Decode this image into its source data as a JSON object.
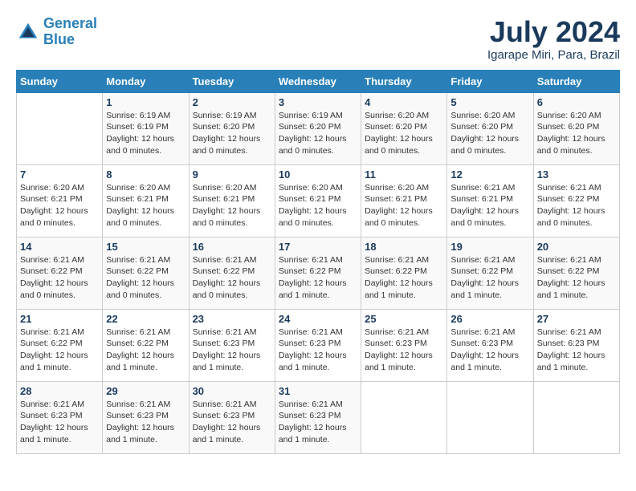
{
  "header": {
    "logo_line1": "General",
    "logo_line2": "Blue",
    "month": "July 2024",
    "location": "Igarape Miri, Para, Brazil"
  },
  "weekdays": [
    "Sunday",
    "Monday",
    "Tuesday",
    "Wednesday",
    "Thursday",
    "Friday",
    "Saturday"
  ],
  "weeks": [
    [
      {
        "day": "",
        "info": ""
      },
      {
        "day": "1",
        "info": "Sunrise: 6:19 AM\nSunset: 6:19 PM\nDaylight: 12 hours and 0 minutes."
      },
      {
        "day": "2",
        "info": "Sunrise: 6:19 AM\nSunset: 6:20 PM\nDaylight: 12 hours and 0 minutes."
      },
      {
        "day": "3",
        "info": "Sunrise: 6:19 AM\nSunset: 6:20 PM\nDaylight: 12 hours and 0 minutes."
      },
      {
        "day": "4",
        "info": "Sunrise: 6:20 AM\nSunset: 6:20 PM\nDaylight: 12 hours and 0 minutes."
      },
      {
        "day": "5",
        "info": "Sunrise: 6:20 AM\nSunset: 6:20 PM\nDaylight: 12 hours and 0 minutes."
      },
      {
        "day": "6",
        "info": "Sunrise: 6:20 AM\nSunset: 6:20 PM\nDaylight: 12 hours and 0 minutes."
      }
    ],
    [
      {
        "day": "7",
        "info": "Sunrise: 6:20 AM\nSunset: 6:21 PM\nDaylight: 12 hours and 0 minutes."
      },
      {
        "day": "8",
        "info": "Sunrise: 6:20 AM\nSunset: 6:21 PM\nDaylight: 12 hours and 0 minutes."
      },
      {
        "day": "9",
        "info": "Sunrise: 6:20 AM\nSunset: 6:21 PM\nDaylight: 12 hours and 0 minutes."
      },
      {
        "day": "10",
        "info": "Sunrise: 6:20 AM\nSunset: 6:21 PM\nDaylight: 12 hours and 0 minutes."
      },
      {
        "day": "11",
        "info": "Sunrise: 6:20 AM\nSunset: 6:21 PM\nDaylight: 12 hours and 0 minutes."
      },
      {
        "day": "12",
        "info": "Sunrise: 6:21 AM\nSunset: 6:21 PM\nDaylight: 12 hours and 0 minutes."
      },
      {
        "day": "13",
        "info": "Sunrise: 6:21 AM\nSunset: 6:22 PM\nDaylight: 12 hours and 0 minutes."
      }
    ],
    [
      {
        "day": "14",
        "info": "Sunrise: 6:21 AM\nSunset: 6:22 PM\nDaylight: 12 hours and 0 minutes."
      },
      {
        "day": "15",
        "info": "Sunrise: 6:21 AM\nSunset: 6:22 PM\nDaylight: 12 hours and 0 minutes."
      },
      {
        "day": "16",
        "info": "Sunrise: 6:21 AM\nSunset: 6:22 PM\nDaylight: 12 hours and 0 minutes."
      },
      {
        "day": "17",
        "info": "Sunrise: 6:21 AM\nSunset: 6:22 PM\nDaylight: 12 hours and 1 minute."
      },
      {
        "day": "18",
        "info": "Sunrise: 6:21 AM\nSunset: 6:22 PM\nDaylight: 12 hours and 1 minute."
      },
      {
        "day": "19",
        "info": "Sunrise: 6:21 AM\nSunset: 6:22 PM\nDaylight: 12 hours and 1 minute."
      },
      {
        "day": "20",
        "info": "Sunrise: 6:21 AM\nSunset: 6:22 PM\nDaylight: 12 hours and 1 minute."
      }
    ],
    [
      {
        "day": "21",
        "info": "Sunrise: 6:21 AM\nSunset: 6:22 PM\nDaylight: 12 hours and 1 minute."
      },
      {
        "day": "22",
        "info": "Sunrise: 6:21 AM\nSunset: 6:22 PM\nDaylight: 12 hours and 1 minute."
      },
      {
        "day": "23",
        "info": "Sunrise: 6:21 AM\nSunset: 6:23 PM\nDaylight: 12 hours and 1 minute."
      },
      {
        "day": "24",
        "info": "Sunrise: 6:21 AM\nSunset: 6:23 PM\nDaylight: 12 hours and 1 minute."
      },
      {
        "day": "25",
        "info": "Sunrise: 6:21 AM\nSunset: 6:23 PM\nDaylight: 12 hours and 1 minute."
      },
      {
        "day": "26",
        "info": "Sunrise: 6:21 AM\nSunset: 6:23 PM\nDaylight: 12 hours and 1 minute."
      },
      {
        "day": "27",
        "info": "Sunrise: 6:21 AM\nSunset: 6:23 PM\nDaylight: 12 hours and 1 minute."
      }
    ],
    [
      {
        "day": "28",
        "info": "Sunrise: 6:21 AM\nSunset: 6:23 PM\nDaylight: 12 hours and 1 minute."
      },
      {
        "day": "29",
        "info": "Sunrise: 6:21 AM\nSunset: 6:23 PM\nDaylight: 12 hours and 1 minute."
      },
      {
        "day": "30",
        "info": "Sunrise: 6:21 AM\nSunset: 6:23 PM\nDaylight: 12 hours and 1 minute."
      },
      {
        "day": "31",
        "info": "Sunrise: 6:21 AM\nSunset: 6:23 PM\nDaylight: 12 hours and 1 minute."
      },
      {
        "day": "",
        "info": ""
      },
      {
        "day": "",
        "info": ""
      },
      {
        "day": "",
        "info": ""
      }
    ]
  ]
}
